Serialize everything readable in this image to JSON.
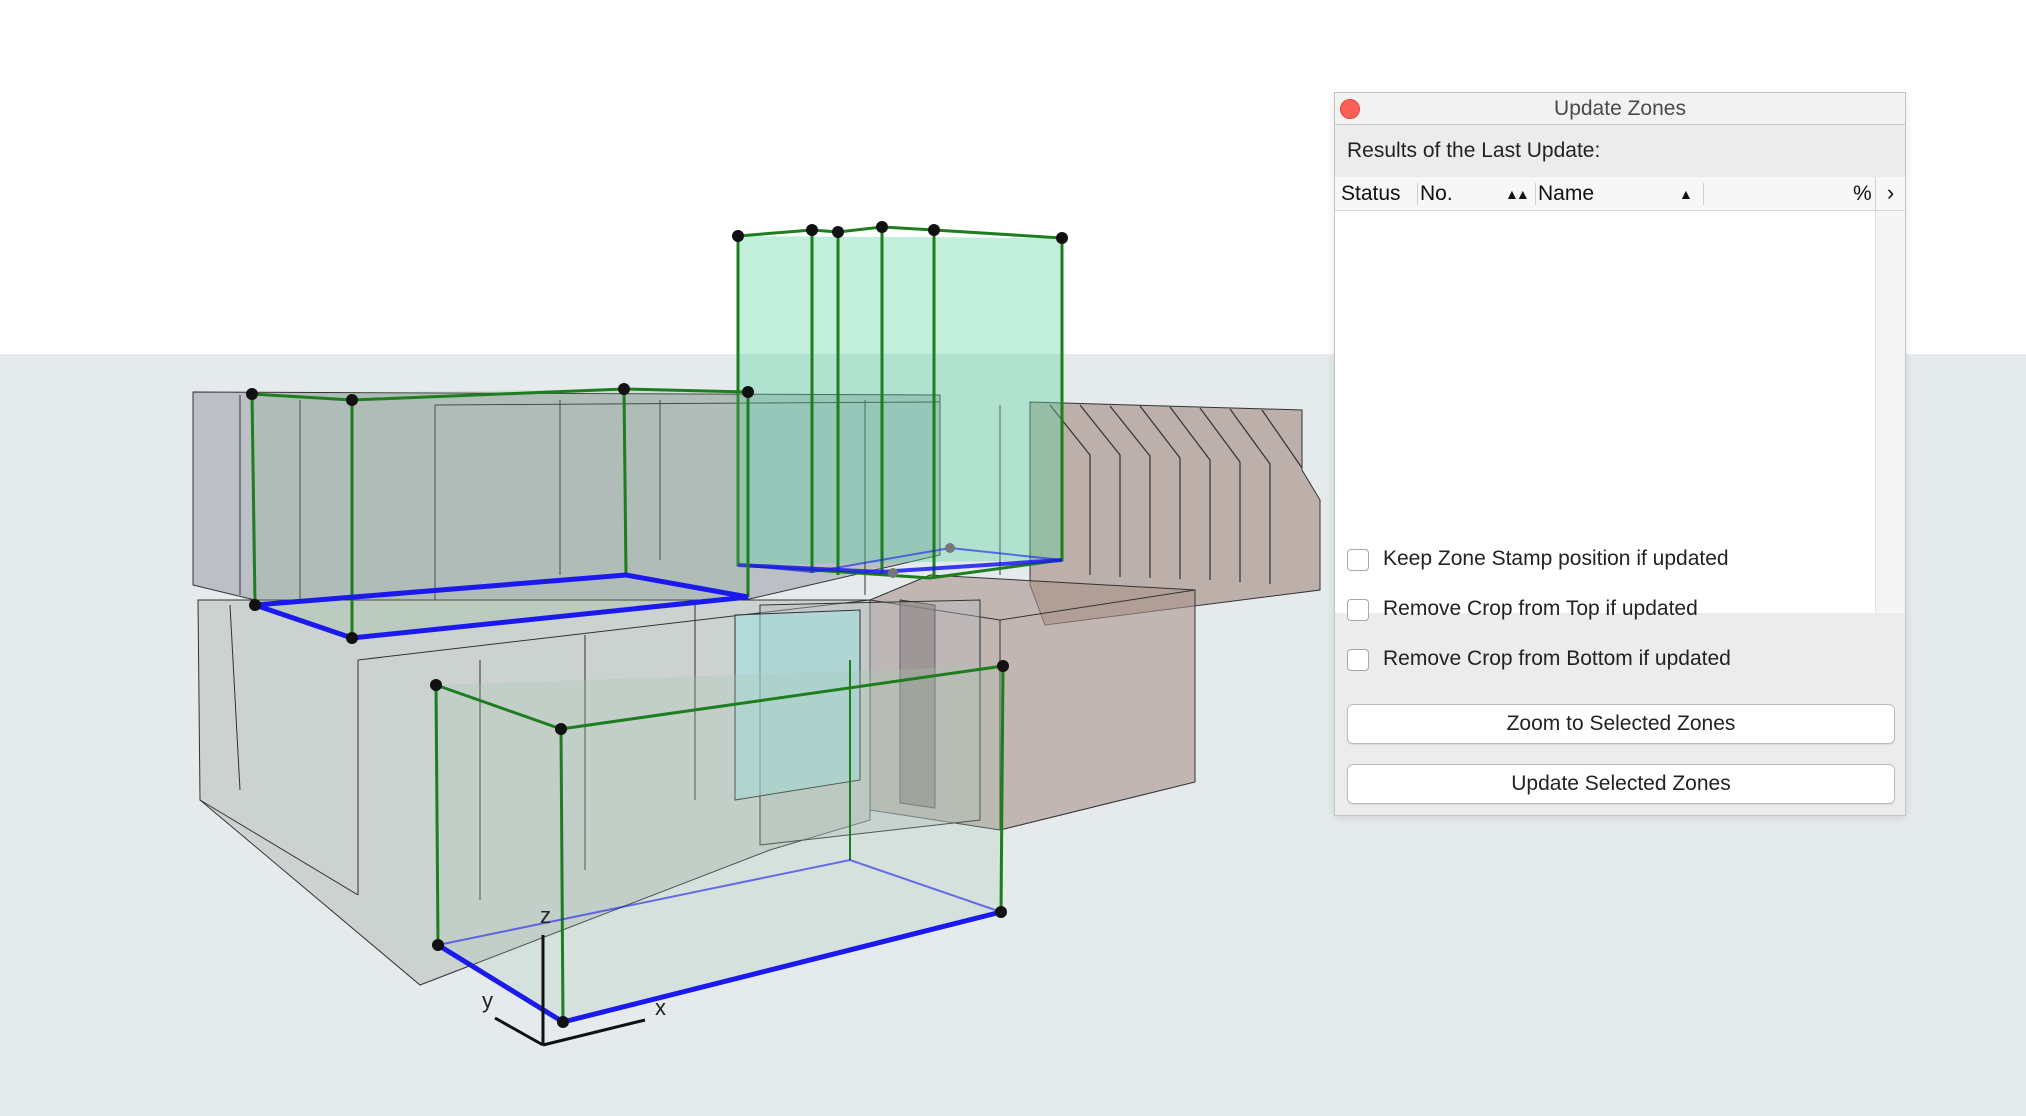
{
  "palette": {
    "title": "Update Zones",
    "results_label": "Results of the Last Update:",
    "columns": {
      "status": "Status",
      "no": "No.",
      "name": "Name",
      "percent": "%"
    },
    "options": [
      {
        "label": "Keep Zone Stamp position if updated",
        "checked": false
      },
      {
        "label": "Remove Crop from Top if updated",
        "checked": false
      },
      {
        "label": "Remove Crop from Bottom if updated",
        "checked": false
      }
    ],
    "buttons": {
      "zoom": "Zoom to Selected Zones",
      "update": "Update Selected Zones"
    }
  },
  "viewport": {
    "axes": {
      "x": "x",
      "y": "y",
      "z": "z"
    },
    "colors": {
      "sky": "#ffffff",
      "ground": "#e5eaec",
      "zone_edge": "#1e7d1e",
      "zone_base": "#1a1aee",
      "vertex": "#111111"
    }
  }
}
